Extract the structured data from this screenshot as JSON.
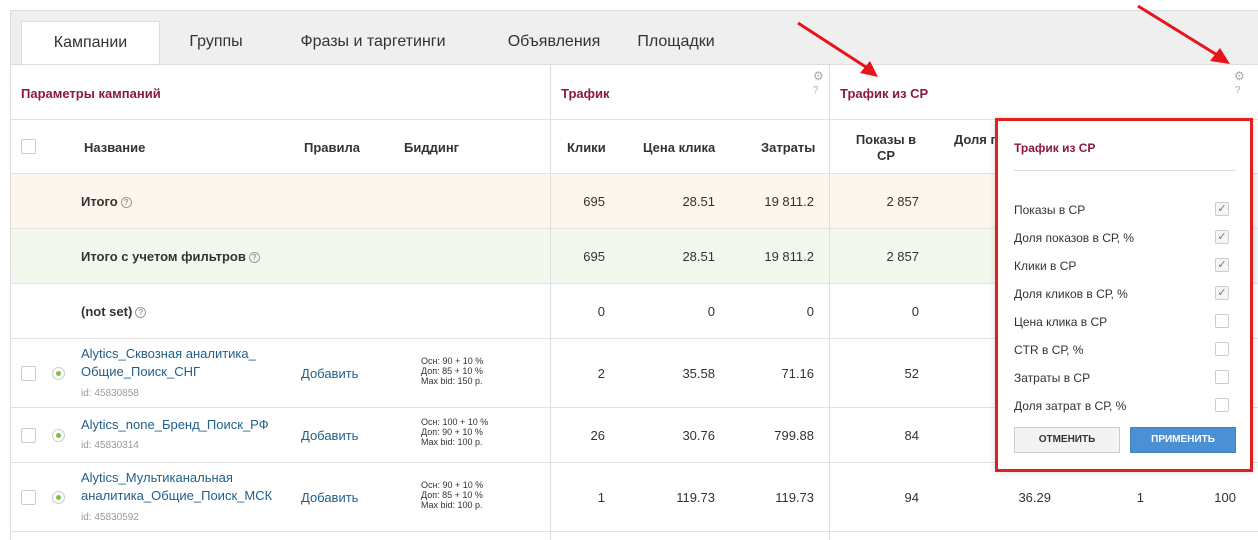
{
  "tabs": [
    {
      "label": "Кампании",
      "active": true
    },
    {
      "label": "Группы"
    },
    {
      "label": "Фразы и таргетинги"
    },
    {
      "label": "Объявления"
    },
    {
      "label": "Площадки"
    }
  ],
  "groups": {
    "params": "Параметры кампаний",
    "traffic": "Трафик",
    "traffic_cp": "Трафик из СР"
  },
  "columns": {
    "name": "Название",
    "rules": "Правила",
    "bidding": "Биддинг",
    "clicks": "Клики",
    "click_price": "Цена клика",
    "costs": "Затраты",
    "shows_cp": "Показы в СР",
    "share_partial": "Доля п"
  },
  "help_mark": "?",
  "summary_rows": [
    {
      "label": "Итого",
      "clicks": "695",
      "click_price": "28.51",
      "costs": "19 811.2",
      "shows_cp": "2 857"
    },
    {
      "label": "Итого с учетом фильтров",
      "clicks": "695",
      "click_price": "28.51",
      "costs": "19 811.2",
      "shows_cp": "2 857"
    },
    {
      "label": "(not set)",
      "clicks": "0",
      "click_price": "0",
      "costs": "0",
      "shows_cp": "0"
    }
  ],
  "campaigns": [
    {
      "name_line1": "Alytics_Сквозная аналитика_",
      "name_line2": "Общие_Поиск_СНГ",
      "id": "id: 45830858",
      "rules": "Добавить",
      "bid": [
        "Осн: 90 + 10 %",
        "Доп: 85 + 10 %",
        "Max bid: 150 р."
      ],
      "clicks": "2",
      "click_price": "35.58",
      "costs": "71.16",
      "shows_cp": "52"
    },
    {
      "name_line1": "Alytics_none_Бренд_Поиск_РФ",
      "name_line2": "",
      "id": "id: 45830314",
      "rules": "Добавить",
      "bid": [
        "Осн: 100 + 10 %",
        "Доп: 90 + 10 %",
        "Max bid: 100 р."
      ],
      "clicks": "26",
      "click_price": "30.76",
      "costs": "799.88",
      "shows_cp": "84"
    },
    {
      "name_line1": "Alytics_Мультиканальная",
      "name_line2": "аналитика_Общие_Поиск_МСК",
      "id": "id: 45830592",
      "rules": "Добавить",
      "bid": [
        "Осн: 90 + 10 %",
        "Доп: 85 + 10 %",
        "Max bid: 100 р."
      ],
      "clicks": "1",
      "click_price": "119.73",
      "costs": "119.73",
      "shows_cp": "94",
      "extra": [
        "36.29",
        "1",
        "100"
      ]
    }
  ],
  "popup": {
    "title": "Трафик из СР",
    "items": [
      {
        "label": "Показы в СР",
        "checked": true
      },
      {
        "label": "Доля показов в СР, %",
        "checked": true
      },
      {
        "label": "Клики в СР",
        "checked": true
      },
      {
        "label": "Доля кликов в СР, %",
        "checked": true
      },
      {
        "label": "Цена клика в СР",
        "checked": false
      },
      {
        "label": "CTR в СР, %",
        "checked": false
      },
      {
        "label": "Затраты в СР",
        "checked": false
      },
      {
        "label": "Доля затрат в СР, %",
        "checked": false
      }
    ],
    "cancel": "ОТМЕНИТЬ",
    "apply": "ПРИМЕНИТЬ"
  },
  "colors": {
    "accent": "#8b1a3a",
    "link": "#1f5f8b",
    "highlight_border": "#e02020",
    "apply": "#4a90d2",
    "row_total": "#fdf6ec",
    "row_filtered": "#f3f8ee"
  }
}
